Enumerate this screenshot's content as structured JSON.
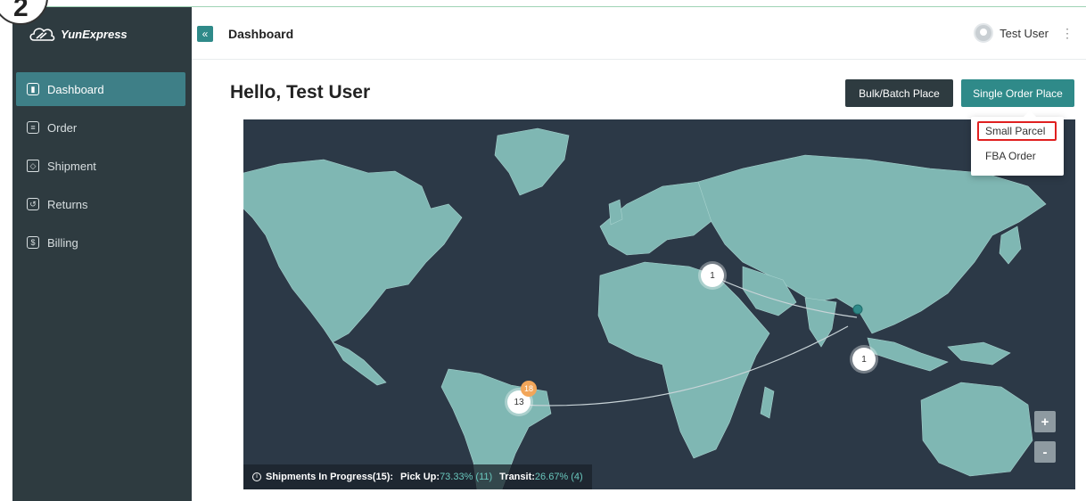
{
  "step_number": "2",
  "app": {
    "logo_text": "YunExpress"
  },
  "sidebar": {
    "items": [
      {
        "label": "Dashboard",
        "icon": "chart-icon",
        "active": true
      },
      {
        "label": "Order",
        "icon": "list-icon",
        "active": false
      },
      {
        "label": "Shipment",
        "icon": "box-icon",
        "active": false
      },
      {
        "label": "Returns",
        "icon": "return-icon",
        "active": false
      },
      {
        "label": "Billing",
        "icon": "dollar-icon",
        "active": false
      }
    ]
  },
  "header": {
    "collapse_icon": "«",
    "title": "Dashboard",
    "user_name": "Test User",
    "menu_icon": "⋮"
  },
  "main": {
    "greeting": "Hello, Test User",
    "bulk_button": "Bulk/Batch Place",
    "single_button": "Single Order Place"
  },
  "dropdown": {
    "items": [
      "Small Parcel",
      "FBA Order"
    ],
    "highlighted": "Small Parcel"
  },
  "map": {
    "clusters": [
      "1",
      "1",
      "13",
      "18"
    ],
    "zoom_in": "+",
    "zoom_out": "-",
    "status": {
      "prefix": "Shipments In Progress(15):",
      "pickup_label": "Pick Up:",
      "pickup_value": "73.33% (11)",
      "transit_label": "Transit:",
      "transit_value": "26.67% (4)"
    }
  },
  "colors": {
    "sidebar_bg": "#2e3b40",
    "active_item": "#3e7f87",
    "accent": "#2f8a89",
    "map_bg": "#2c3947",
    "land": "#7fb7b3",
    "badge_orange": "#f2a65a"
  }
}
